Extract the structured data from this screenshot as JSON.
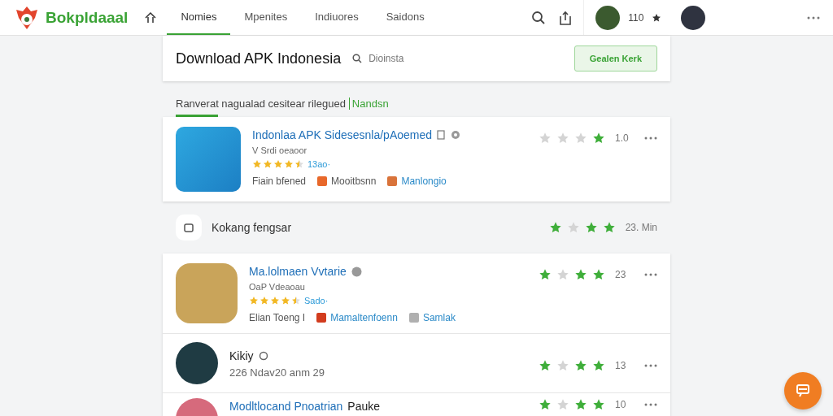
{
  "header": {
    "logo": "Bokpldaaal",
    "nav": [
      {
        "label": "Nomies",
        "selected": true
      },
      {
        "label": "Mpenites",
        "selected": false
      },
      {
        "label": "Indiuores",
        "selected": false
      },
      {
        "label": "Saidons",
        "selected": false
      }
    ],
    "count": "110"
  },
  "search_card": {
    "title": "Download APK Indonesia",
    "search_value": "Dioinsta",
    "button": "Gealen Kerk"
  },
  "section_heading": {
    "text": "Ranverat nagualad cesitear rilegued",
    "link": "Nandsn"
  },
  "featured_app": {
    "title": "Indonlaa APK Sidesesnla/pAoemed",
    "subtitle": "V Srdi oeaoor",
    "stars": 4.5,
    "rating_text": "13ao·",
    "meta": [
      {
        "kind": "plain",
        "text": "Fiain bfened"
      },
      {
        "kind": "tag",
        "text": "Mooitbsnn",
        "color": "#e8682a"
      },
      {
        "kind": "link",
        "text": "Manlongio",
        "color": "#d9733a"
      }
    ],
    "rating": [
      false,
      false,
      false,
      true
    ],
    "score": "1.0"
  },
  "group": {
    "title": "Kokang fengsar",
    "rating": [
      true,
      false,
      true,
      true
    ],
    "score": "23. Min"
  },
  "items": [
    {
      "kind": "app",
      "title": "Ma.lolmaen Vvtarie",
      "subtitle": "OaP Vdeaoau",
      "stars": 4.5,
      "rating_text": "Sado·",
      "meta": [
        {
          "kind": "plain",
          "text": "Elian Toeng I"
        },
        {
          "kind": "link",
          "text": "Mamaltenfoenn",
          "color": "#d23c1e"
        },
        {
          "kind": "link",
          "text": "Samlak",
          "color": "#b0b0b0"
        }
      ],
      "rating": [
        true,
        false,
        true,
        true
      ],
      "score": "23"
    },
    {
      "kind": "person",
      "title": "Kikiy",
      "subtitle": "226 Ndav20 anm 29",
      "rating": [
        true,
        false,
        true,
        true
      ],
      "score": "13"
    },
    {
      "kind": "partial",
      "title": "Modltlocand Pnoatrian",
      "title_suffix": "Pauke",
      "rating": [
        true,
        false,
        true,
        true
      ],
      "score": "10"
    }
  ]
}
